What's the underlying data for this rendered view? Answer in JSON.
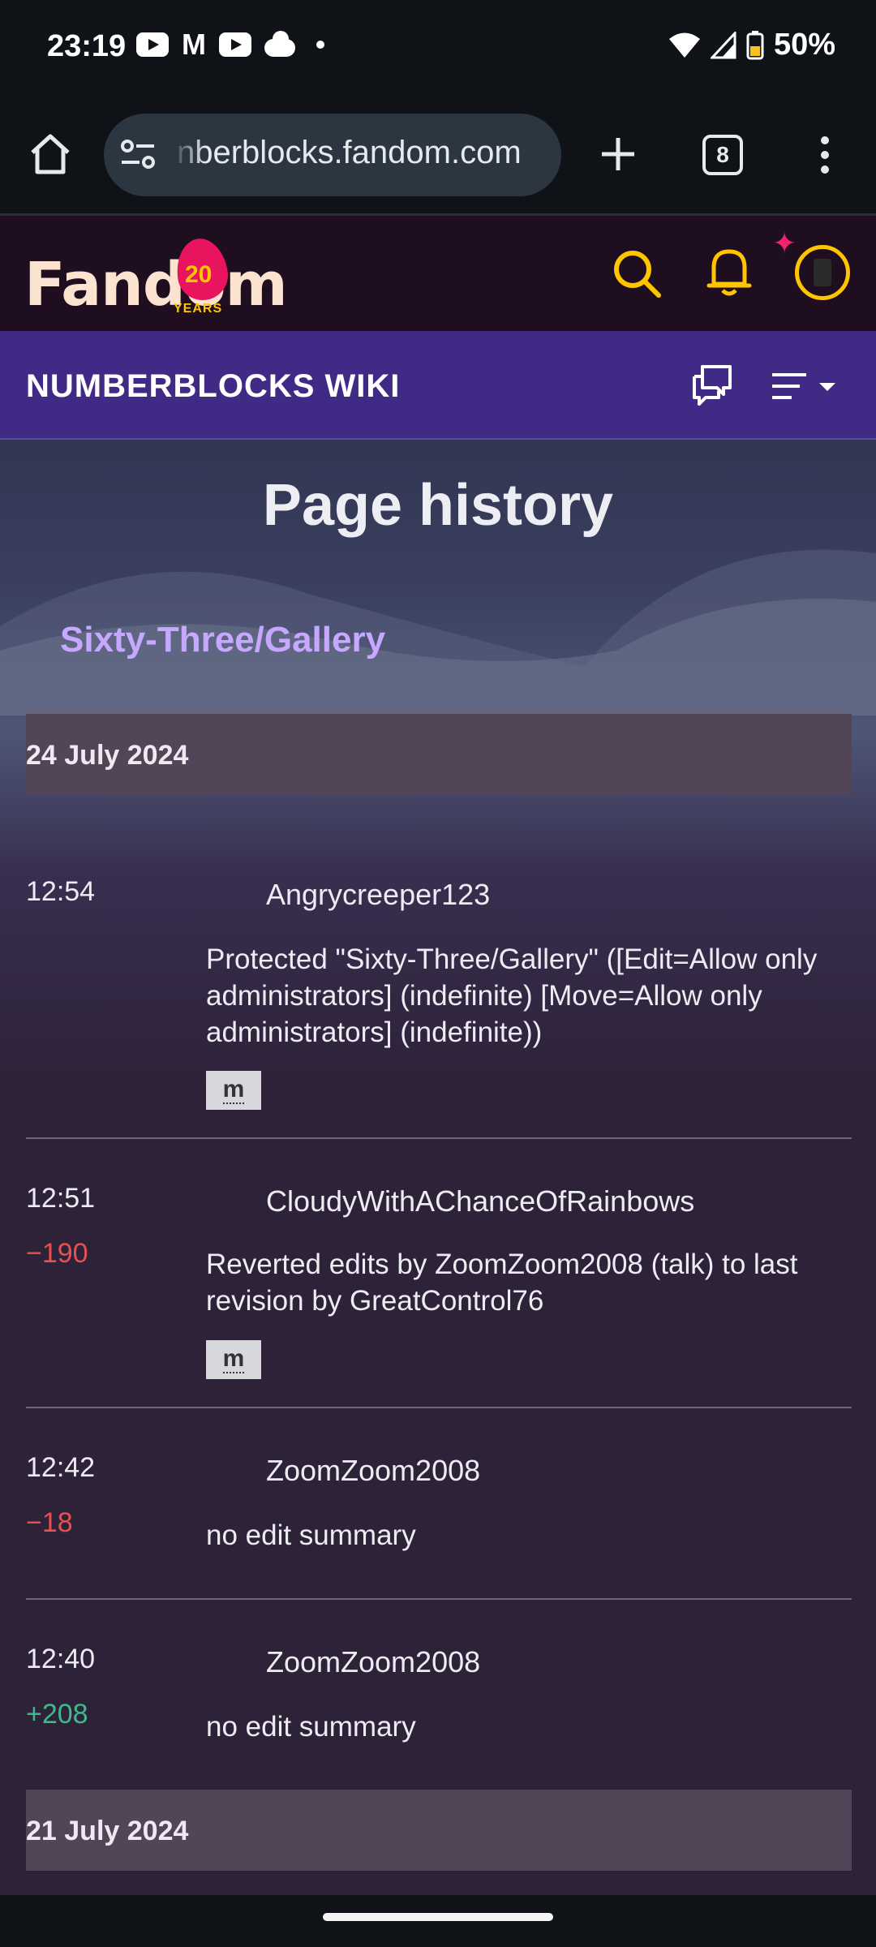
{
  "status_bar": {
    "time": "23:19",
    "notification_icons": [
      "youtube-icon",
      "gmail-icon",
      "youtube-icon",
      "cloud-icon",
      "dot-icon"
    ],
    "battery_percent": "50%"
  },
  "browser": {
    "url": "nberblocks.fandom.com",
    "tab_count": "8"
  },
  "fandom_nav": {
    "logo_text": "Fandom",
    "logo_badge": "20",
    "logo_sub": "YEARS"
  },
  "community": {
    "name": "NUMBERBLOCKS WIKI"
  },
  "page": {
    "title": "Page history",
    "subject": "Sixty-Three/Gallery"
  },
  "history": [
    {
      "date": "24 July 2024",
      "revisions": [
        {
          "time": "12:54",
          "diff": "",
          "user": "Angrycreeper123",
          "summary": "Protected \"Sixty-Three/Gallery\" ([Edit=Allow only administrators] (indefinite) [Move=Allow only administrators] (indefinite))",
          "minor": "m"
        },
        {
          "time": "12:51",
          "diff": "−190",
          "user": "CloudyWithAChanceOfRainbows",
          "summary": "Reverted edits by ZoomZoom2008 (talk) to last revision by GreatControl76",
          "minor": "m"
        },
        {
          "time": "12:42",
          "diff": "−18",
          "user": "ZoomZoom2008",
          "summary": "no edit summary",
          "minor": ""
        },
        {
          "time": "12:40",
          "diff": "+208",
          "user": "ZoomZoom2008",
          "summary": "no edit summary",
          "minor": ""
        }
      ]
    },
    {
      "date": "21 July 2024",
      "revisions": []
    }
  ],
  "colors": {
    "accent_gold": "#ffc500",
    "community_bar": "#412a86",
    "subject_link": "#c6a8ff",
    "diff_negative": "#e85050",
    "diff_positive": "#3fb98a"
  }
}
